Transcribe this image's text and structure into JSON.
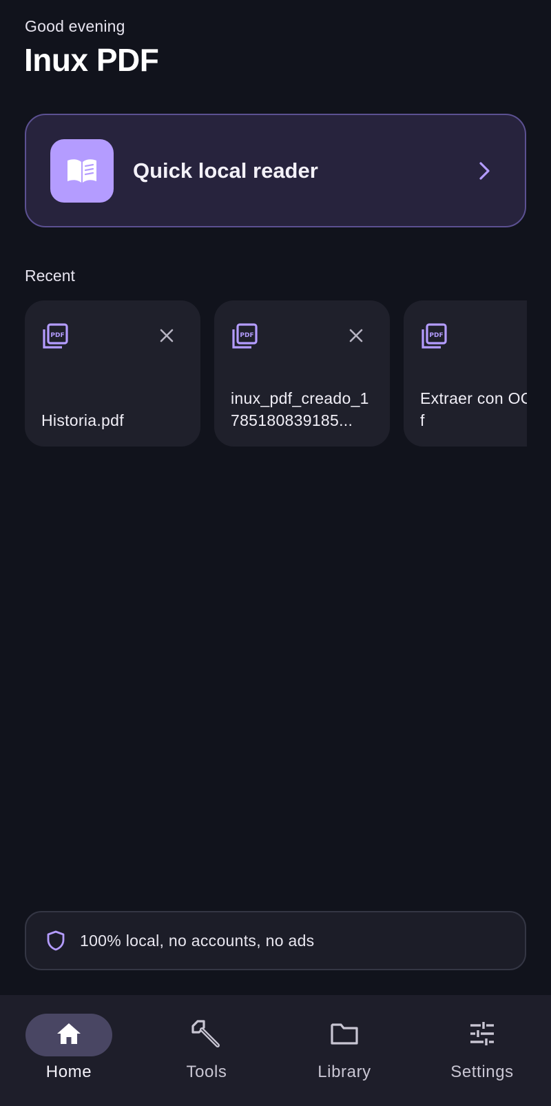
{
  "header": {
    "greeting": "Good evening",
    "title": "Inux PDF"
  },
  "quick_reader": {
    "label": "Quick local reader",
    "icon": "open-book-icon",
    "chevron_icon": "chevron-right-icon"
  },
  "recent": {
    "section_label": "Recent",
    "files": [
      {
        "name": "Historia.pdf",
        "icon": "pdf-file-icon",
        "removable": true
      },
      {
        "name": "inux_pdf_creado_1785180839185...",
        "icon": "pdf-file-icon",
        "removable": true
      },
      {
        "name": "Extraer con OCR.pdf",
        "icon": "pdf-file-icon",
        "removable": false
      }
    ]
  },
  "privacy": {
    "icon": "shield-icon",
    "text": "100% local, no accounts, no ads"
  },
  "nav": {
    "items": [
      {
        "label": "Home",
        "icon": "home-icon",
        "active": true
      },
      {
        "label": "Tools",
        "icon": "wrench-icon",
        "active": false
      },
      {
        "label": "Library",
        "icon": "folder-icon",
        "active": false
      },
      {
        "label": "Settings",
        "icon": "sliders-icon",
        "active": false
      }
    ]
  },
  "colors": {
    "background": "#11131c",
    "accent": "#b49cff",
    "card": "#1f202b",
    "quick_card": "#27233d",
    "nav_bar": "#1e1e2a",
    "nav_active_pill": "#494663"
  }
}
